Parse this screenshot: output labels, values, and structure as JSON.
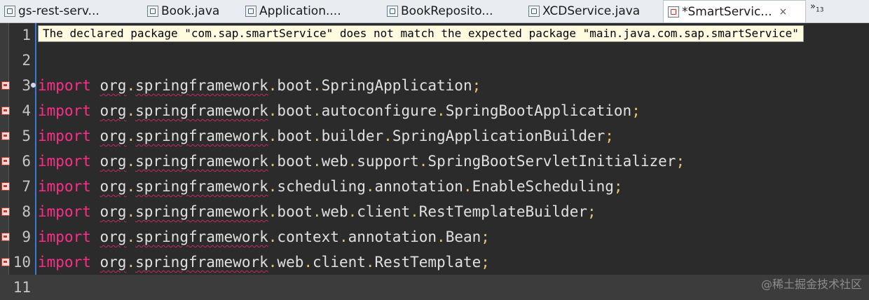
{
  "tabs": [
    {
      "label": "gs-rest-serv...",
      "icon": "maven-file-icon",
      "active": false
    },
    {
      "label": "Book.java",
      "icon": "java-file-icon",
      "active": false
    },
    {
      "label": "Application....",
      "icon": "java-file-icon",
      "active": false
    },
    {
      "label": "BookReposito...",
      "icon": "java-file-icon",
      "active": false
    },
    {
      "label": "XCDService.java",
      "icon": "java-file-icon",
      "active": false
    },
    {
      "label": "*SmartServic...",
      "icon": "java-error-file-icon",
      "active": true,
      "close": "×"
    }
  ],
  "overflow": {
    "label": "»",
    "count": "13"
  },
  "tooltip": "The declared package \"com.sap.smartService\" does not match the expected package \"main.java.com.sap.smartService\"",
  "lines": [
    {
      "n": "1",
      "tokens": []
    },
    {
      "n": "2",
      "tokens": []
    },
    {
      "n": "3",
      "kw": "import",
      "parts": [
        "org",
        ".",
        "springframework",
        ".",
        "boot",
        ".",
        "SpringApplication",
        ";"
      ]
    },
    {
      "n": "4",
      "kw": "import",
      "parts": [
        "org",
        ".",
        "springframework",
        ".",
        "boot",
        ".",
        "autoconfigure",
        ".",
        "SpringBootApplication",
        ";"
      ]
    },
    {
      "n": "5",
      "kw": "import",
      "parts": [
        "org",
        ".",
        "springframework",
        ".",
        "boot",
        ".",
        "builder",
        ".",
        "SpringApplicationBuilder",
        ";"
      ]
    },
    {
      "n": "6",
      "kw": "import",
      "parts": [
        "org",
        ".",
        "springframework",
        ".",
        "boot",
        ".",
        "web",
        ".",
        "support",
        ".",
        "SpringBootServletInitializer",
        ";"
      ]
    },
    {
      "n": "7",
      "kw": "import",
      "parts": [
        "org",
        ".",
        "springframework",
        ".",
        "scheduling",
        ".",
        "annotation",
        ".",
        "EnableScheduling",
        ";"
      ]
    },
    {
      "n": "8",
      "kw": "import",
      "parts": [
        "org",
        ".",
        "springframework",
        ".",
        "boot",
        ".",
        "web",
        ".",
        "client",
        ".",
        "RestTemplateBuilder",
        ";"
      ]
    },
    {
      "n": "9",
      "kw": "import",
      "parts": [
        "org",
        ".",
        "springframework",
        ".",
        "context",
        ".",
        "annotation",
        ".",
        "Bean",
        ";"
      ]
    },
    {
      "n": "10",
      "kw": "import",
      "parts": [
        "org",
        ".",
        "springframework",
        ".",
        "web",
        ".",
        "client",
        ".",
        "RestTemplate",
        ";"
      ]
    },
    {
      "n": "11",
      "tokens": []
    }
  ],
  "watermark": "@稀土掘金技术社区",
  "colors": {
    "keyword": "#ff2d8a",
    "error": "#c4286a",
    "punct": "#e6c36b",
    "bg": "#2b2b2b"
  }
}
